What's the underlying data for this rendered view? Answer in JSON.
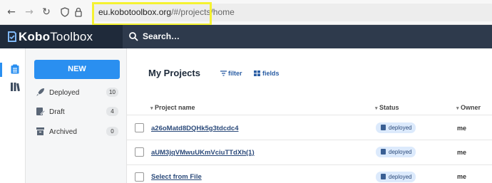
{
  "browser": {
    "back_icon": "←",
    "forward_icon": "→",
    "reload_icon": "↻",
    "url_host": "eu.kobotoolbox.org",
    "url_path": "/#/projects/home"
  },
  "header": {
    "logo_kobo": "Kobo",
    "logo_toolbox": "Toolbox",
    "search_placeholder": "Search…"
  },
  "sidebar": {
    "new_label": "NEW",
    "items": [
      {
        "label": "Deployed",
        "count": "10",
        "icon": "rocket-icon"
      },
      {
        "label": "Draft",
        "count": "4",
        "icon": "pencil-icon"
      },
      {
        "label": "Archived",
        "count": "0",
        "icon": "archive-icon"
      }
    ]
  },
  "main": {
    "title": "My Projects",
    "filter_label": "filter",
    "fields_label": "fields",
    "columns": [
      "Project name",
      "Status",
      "Owner"
    ],
    "rows": [
      {
        "name": "a26oMatd8DQHk5g3tdcdc4",
        "status": "deployed",
        "owner": "me"
      },
      {
        "name": "aUM3jqVMwuUKmVciuTTdXh(1)",
        "status": "deployed",
        "owner": "me"
      },
      {
        "name": "Select from File",
        "status": "deployed",
        "owner": "me"
      }
    ]
  },
  "colors": {
    "header_bg": "#1f2a3a",
    "accent": "#2a8ff0",
    "highlight": "#f5f231"
  }
}
